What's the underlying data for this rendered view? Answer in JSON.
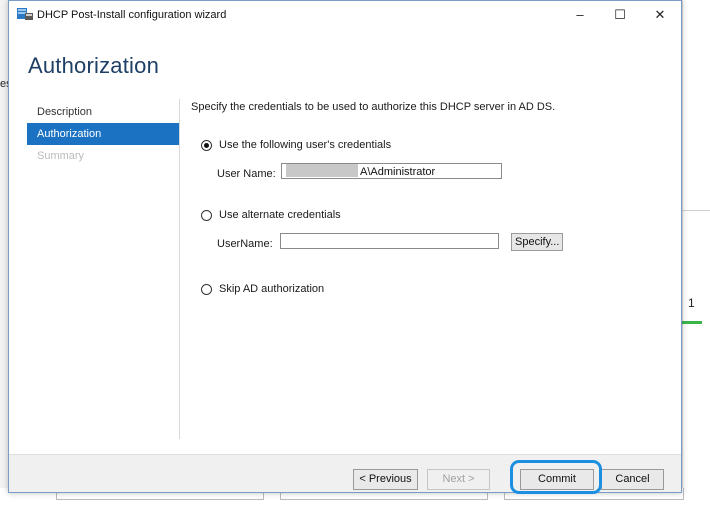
{
  "window": {
    "title": "DHCP Post-Install configuration wizard",
    "controls": {
      "minimize": "–",
      "maximize": "☐",
      "close": "✕"
    }
  },
  "page": {
    "heading": "Authorization"
  },
  "nav": {
    "items": [
      {
        "label": "Description",
        "state": "normal"
      },
      {
        "label": "Authorization",
        "state": "active"
      },
      {
        "label": "Summary",
        "state": "disabled"
      }
    ]
  },
  "content": {
    "intro": "Specify the credentials to be used to authorize this DHCP server in AD DS.",
    "option_user": {
      "label": "Use the following user's credentials",
      "selected": true
    },
    "user_name": {
      "label": "User Name:",
      "value": "A\\Administrator"
    },
    "option_alternate": {
      "label": "Use alternate credentials",
      "selected": false
    },
    "alt_user_name": {
      "label": "UserName:",
      "value": ""
    },
    "specify_button": "Specify...",
    "option_skip": {
      "label": "Skip AD authorization",
      "selected": false
    }
  },
  "footer": {
    "previous": "< Previous",
    "next": "Next >",
    "commit": "Commit",
    "cancel": "Cancel"
  },
  "background": {
    "left_fragment": "es",
    "tab_number": "1"
  },
  "colors": {
    "accent": "#1c72c2",
    "heading": "#1e3f66",
    "highlight_ring": "#1c8fe0",
    "status_green": "#3bb54a"
  }
}
